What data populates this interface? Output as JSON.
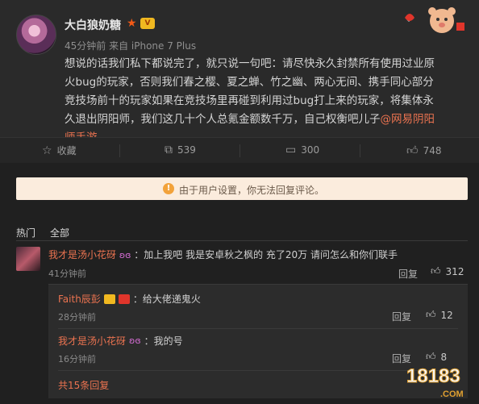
{
  "post": {
    "author": "大白狼奶糖",
    "meta": "45分钟前 来自 iPhone 7 Plus",
    "text_main": "想说的话我们私下都说完了，就只说一句吧：请尽快永久封禁所有使用过业原火bug的玩家，否则我们春之樱、夏之蝉、竹之幽、两心无间、携手同心部分竞技场前十的玩家如果在竞技场里再碰到利用过bug打上来的玩家，将集体永久退出阴阳师，我们这几十个人总氪金额数千万，自己权衡吧儿子",
    "mention": "@网易阴阳师手游"
  },
  "actions": {
    "favorite_label": "收藏",
    "share_count": "539",
    "comment_count": "300",
    "like_count": "748"
  },
  "notice": {
    "text": "由于用户设置，你无法回复评论。"
  },
  "tabs": {
    "hot": "热门",
    "all": "全部"
  },
  "comment": {
    "name": "我才是汤小花砑",
    "text": "：加上我吧 我是安卓秋之枫的 充了20万 请问怎么和你们联手",
    "time": "41分钟前",
    "reply_label": "回复",
    "likes": "312"
  },
  "replies": [
    {
      "name": "Faith辰彭",
      "text": "：给大佬递鬼火",
      "time": "28分钟前",
      "reply_label": "回复",
      "likes": "12"
    },
    {
      "name": "我才是汤小花砑",
      "text": "：我的号",
      "time": "16分钟前",
      "reply_label": "回复",
      "likes": "8"
    }
  ],
  "reply_total": "共15条回复",
  "watermark": "18183",
  "watermark_sub": ".COM",
  "colors": {
    "accent": "#eb7350",
    "star": "#f35a16",
    "notice_bg": "#fbecdd",
    "notice_icon": "#f2a23a"
  }
}
